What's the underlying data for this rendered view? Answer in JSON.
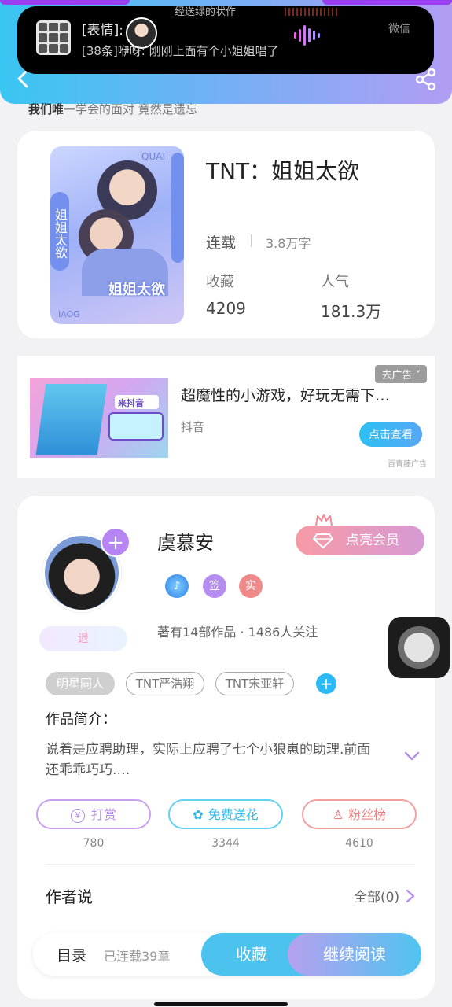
{
  "notification": {
    "ghost_text": "经送绿的状作",
    "line1": "[表情]:",
    "line2": "[38条]咿呀: 刚刚上面有个小姐姐唱了",
    "app_name": "微信"
  },
  "header": {
    "subtitle_bold": "我们唯一",
    "subtitle_rest": "学会的面对 竟然是遗忘"
  },
  "book": {
    "title": "TNT：姐姐太欲",
    "cover_text": "姐姐太欲",
    "cover_side_text": "姐姐太欲",
    "cover_mark_top": "QUAI",
    "cover_mark_bottom": "IAOG",
    "status": "连载",
    "word_count": "3.8万字",
    "favorites_label": "收藏",
    "favorites_value": "4209",
    "popularity_label": "人气",
    "popularity_value": "181.3万"
  },
  "ad": {
    "badge": "去广告 ˅",
    "title": "超魔性的小游戏，好玩无需下…",
    "source": "抖音",
    "button": "点击查看",
    "provider": "百青藤广告",
    "image_text": "来抖音"
  },
  "author": {
    "name": "虞慕安",
    "vip_button": "点亮会员",
    "retire_badge": "退",
    "medals": [
      "签",
      "实"
    ],
    "stats": "著有14部作品 · 1486人关注",
    "tags": [
      "明星同人",
      "TNT严浩翔",
      "TNT宋亚轩"
    ],
    "intro_label": "作品简介：",
    "intro_text": "说着是应聘助理，实际上应聘了七个小狼崽的助理.前面还乖乖巧巧.…",
    "actions": [
      {
        "label": "打赏",
        "count": "780"
      },
      {
        "label": "免费送花",
        "count": "3344"
      },
      {
        "label": "粉丝榜",
        "count": "4610"
      }
    ],
    "author_says_label": "作者说",
    "all_link": "全部(0)"
  },
  "bottom_bar": {
    "toc": "目录",
    "chapters": "已连载39章",
    "favorite": "收藏",
    "continue": "继续阅读"
  },
  "colors": {
    "accent_blue": "#39c6f2",
    "accent_purple": "#b29df3",
    "vip_pink": "#f79aa5"
  }
}
